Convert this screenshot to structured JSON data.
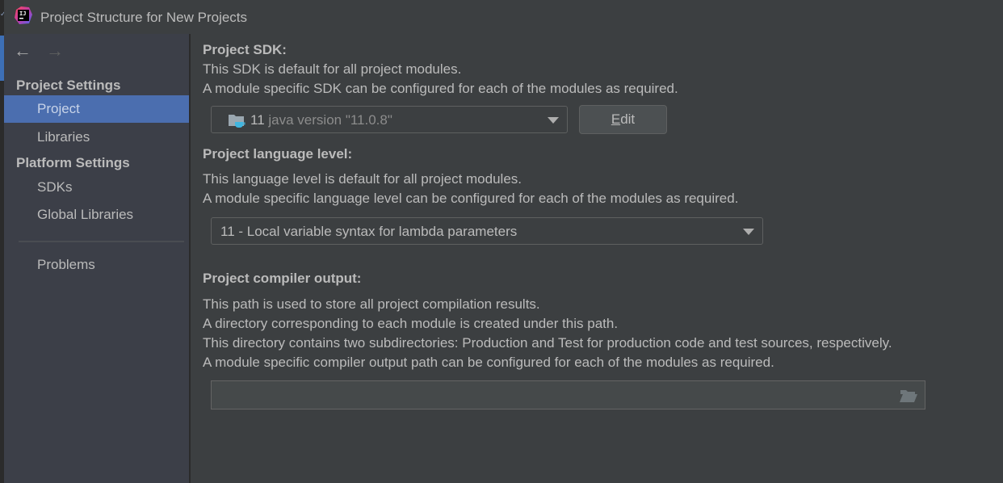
{
  "window": {
    "title": "Project Structure for New Projects",
    "app_icon": "intellij-idea-logo"
  },
  "navigation": {
    "back_icon": "arrow-left-icon",
    "forward_icon": "arrow-right-icon",
    "back_symbol": "←",
    "forward_symbol": "→",
    "forward_enabled": false
  },
  "sidebar": {
    "sections": [
      {
        "header": "Project Settings",
        "items": [
          {
            "label": "Project",
            "selected": true
          },
          {
            "label": "Libraries",
            "selected": false
          }
        ]
      },
      {
        "header": "Platform Settings",
        "items": [
          {
            "label": "SDKs",
            "selected": false
          },
          {
            "label": "Global Libraries",
            "selected": false
          }
        ]
      }
    ],
    "extra_items": [
      {
        "label": "Problems"
      }
    ]
  },
  "main": {
    "sdk": {
      "heading": "Project SDK:",
      "desc_lines": [
        "This SDK is default for all project modules.",
        "A module specific SDK can be configured for each of the modules as required."
      ],
      "selected_name": "11",
      "selected_detail": "java version \"11.0.8\"",
      "icon": "jdk-folder-icon",
      "edit_button": {
        "label": "Edit",
        "mnemonic": "E",
        "rest": "dit"
      }
    },
    "language_level": {
      "heading": "Project language level:",
      "desc_lines": [
        "This language level is default for all project modules.",
        "A module specific language level can be configured for each of the modules as required."
      ],
      "selected": "11 - Local variable syntax for lambda parameters"
    },
    "compiler_output": {
      "heading": "Project compiler output:",
      "desc_lines": [
        "This path is used to store all project compilation results.",
        "A directory corresponding to each module is created under this path.",
        "This directory contains two subdirectories: Production and Test for production code and test sources, respectively.",
        "A module specific compiler output path can be configured for each of the modules as required."
      ],
      "path_value": "",
      "browse_icon": "folder-open-icon"
    }
  },
  "colors": {
    "selection": "#4b6eaf",
    "background": "#3c3f41",
    "sidebar": "#3c3f48",
    "text": "#bbbbbb"
  }
}
